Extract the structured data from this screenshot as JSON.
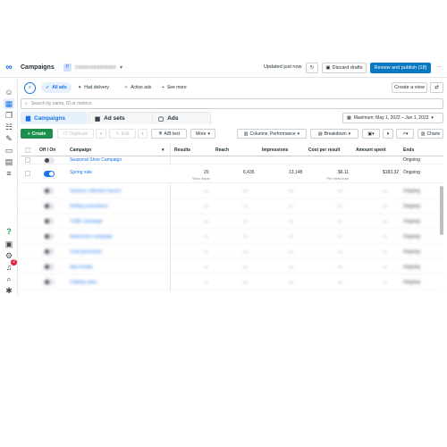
{
  "topbar": {
    "title": "Campaigns",
    "account_badge": "P",
    "account_id": "208886888888888",
    "updated_text": "Updated just now",
    "discard_label": "Discard drafts",
    "review_label": "Review and publish (18)"
  },
  "filters": {
    "all_ads": "All ads",
    "had_delivery": "Had delivery",
    "active_ads": "Active ads",
    "see_more": "See more",
    "create_view": "Create a view"
  },
  "search": {
    "placeholder": "Search by name, ID or metrics"
  },
  "tabs": {
    "campaigns": "Campaigns",
    "ad_sets": "Ad sets",
    "ads": "Ads"
  },
  "date_range": "Maximum: May 1, 2022 – Jun 1, 2023",
  "toolbar": {
    "create": "Create",
    "duplicate": "Duplicate",
    "edit": "Edit",
    "ab_test": "A/B test",
    "more": "More",
    "columns": "Columns: Performance",
    "breakdown": "Breakdown",
    "charts": "Charts"
  },
  "columns": {
    "off_on": "Off / On",
    "campaign": "Campaign",
    "results": "Results",
    "reach": "Reach",
    "impressions": "Impressions",
    "cost_per_result": "Cost per result",
    "amount_spent": "Amount spent",
    "ends": "Ends"
  },
  "rows": [
    {
      "campaign": "Seasonal Shoe Campaign",
      "results": "",
      "reach": "",
      "impressions": "",
      "cost": "",
      "spent": "",
      "ends": "Ongoing"
    },
    {
      "campaign": "Spring sale",
      "results": "20",
      "results_sub": "Sites leads",
      "reach": "6,435",
      "impressions": "13,148",
      "cost": "$6.11",
      "cost_sub": "Per Meta lead",
      "spent": "$183.32",
      "ends": "Ongoing"
    },
    {
      "campaign": "Summer collection launch",
      "results": "—",
      "reach": "—",
      "impressions": "—",
      "cost": "—",
      "spent": "—",
      "ends": "Ongoing"
    },
    {
      "campaign": "Holiday promotions",
      "results": "—",
      "reach": "—",
      "impressions": "—",
      "cost": "—",
      "spent": "—",
      "ends": "Ongoing"
    },
    {
      "campaign": "Traffic campaign",
      "results": "—",
      "reach": "—",
      "impressions": "—",
      "cost": "—",
      "spent": "—",
      "ends": "Ongoing"
    },
    {
      "campaign": "Awareness campaign",
      "results": "—",
      "reach": "—",
      "impressions": "—",
      "cost": "—",
      "spent": "—",
      "ends": "Ongoing"
    },
    {
      "campaign": "Lead generation",
      "results": "—",
      "reach": "—",
      "impressions": "—",
      "cost": "—",
      "spent": "—",
      "ends": "Ongoing"
    },
    {
      "campaign": "App installs",
      "results": "—",
      "reach": "—",
      "impressions": "—",
      "cost": "—",
      "spent": "—",
      "ends": "Ongoing"
    },
    {
      "campaign": "Catalog sales",
      "results": "—",
      "reach": "—",
      "impressions": "—",
      "cost": "—",
      "spent": "—",
      "ends": "Ongoing"
    }
  ],
  "notifications_count": "2"
}
